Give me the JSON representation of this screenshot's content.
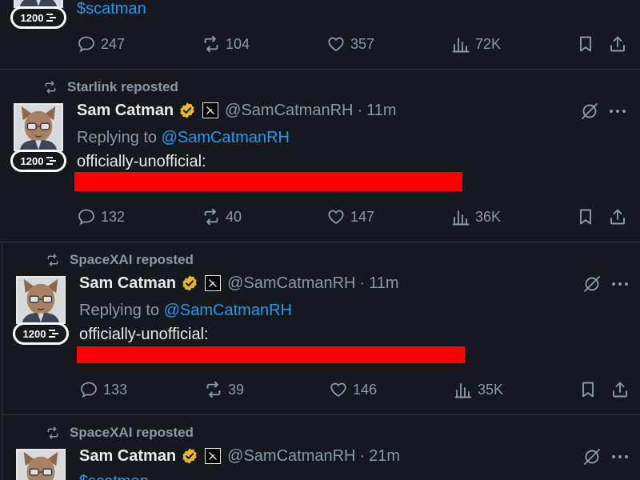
{
  "tweets": [
    {
      "cashtag": "$scatman",
      "badge": "1200",
      "counts": {
        "replies": "247",
        "reposts": "104",
        "likes": "357",
        "views": "72K"
      }
    },
    {
      "repost_by": "Starlink reposted",
      "name": "Sam Catman",
      "handle": "@SamCatmanRH",
      "dot": "·",
      "time": "11m",
      "badge": "1200",
      "replying_prefix": "Replying to",
      "replying_handle": "@SamCatmanRH",
      "text": "officially-unofficial:",
      "counts": {
        "replies": "132",
        "reposts": "40",
        "likes": "147",
        "views": "36K"
      }
    },
    {
      "repost_by": "SpaceXAI reposted",
      "name": "Sam Catman",
      "handle": "@SamCatmanRH",
      "dot": "·",
      "time": "11m",
      "badge": "1200",
      "replying_prefix": "Replying to",
      "replying_handle": "@SamCatmanRH",
      "text": "officially-unofficial:",
      "counts": {
        "replies": "133",
        "reposts": "39",
        "likes": "146",
        "views": "35K"
      }
    },
    {
      "repost_by": "SpaceXAI reposted",
      "name": "Sam Catman",
      "handle": "@SamCatmanRH",
      "dot": "·",
      "time": "21m",
      "cashtag": "$scatman"
    }
  ],
  "colors": {
    "background": "#15181c",
    "link": "#1d9bf0",
    "muted": "#8b98a5",
    "verified": "#e8b829",
    "redacted": "#ff0000"
  },
  "icons": [
    "repost-icon",
    "verified-badge-icon",
    "affiliate-x-icon",
    "grok-icon",
    "more-icon",
    "reply-icon",
    "like-icon",
    "views-icon",
    "bookmark-icon",
    "share-icon"
  ]
}
